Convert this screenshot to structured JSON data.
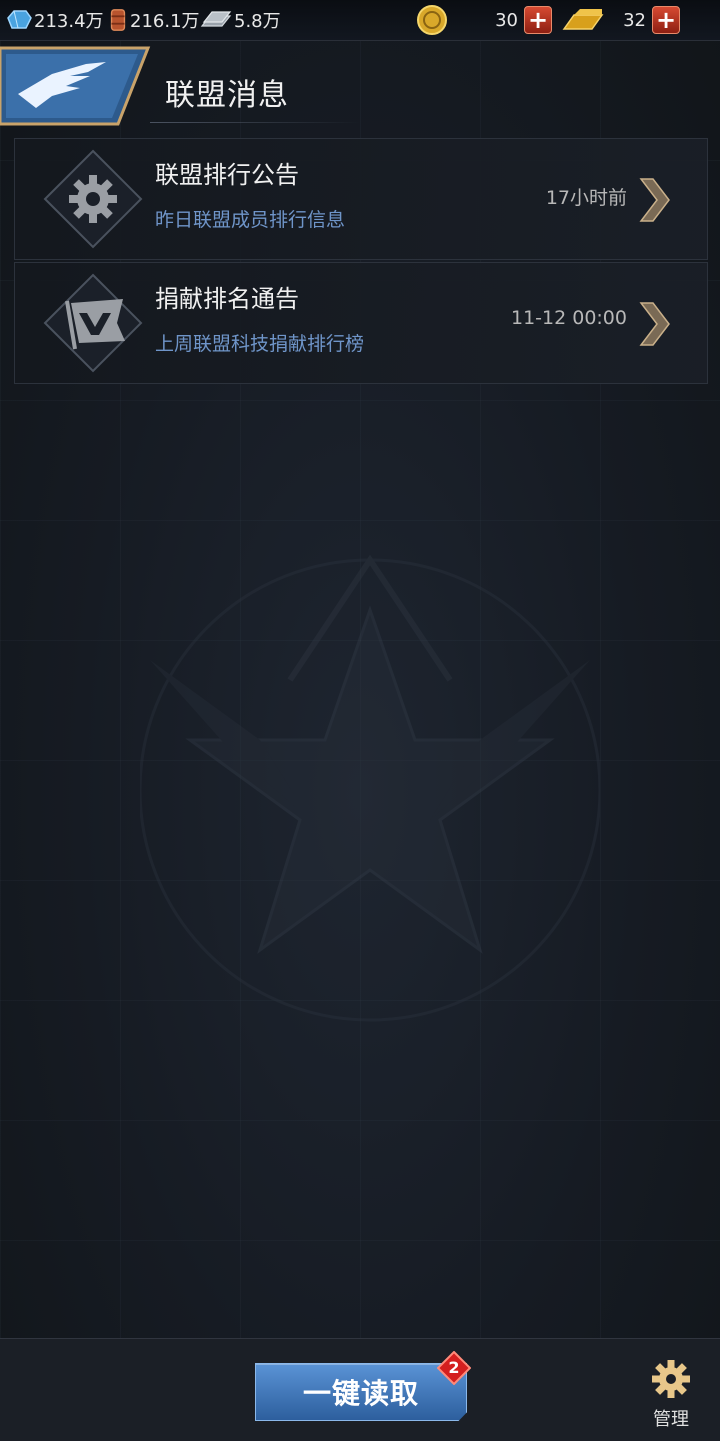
{
  "topbar": {
    "resources": [
      {
        "icon": "crystal-icon",
        "value": "213.4万"
      },
      {
        "icon": "oil-barrel-icon",
        "value": "216.1万"
      },
      {
        "icon": "steel-ingot-icon",
        "value": "5.8万"
      }
    ],
    "premium": [
      {
        "icon": "gold-coin-icon",
        "value": "30"
      },
      {
        "icon": "gold-bar-icon",
        "value": "32"
      }
    ]
  },
  "header": {
    "title": "联盟消息",
    "badge_icon": "eagle-icon"
  },
  "messages": [
    {
      "title": "联盟排行公告",
      "subtitle": "昨日联盟成员排行信息",
      "time": "17小时前",
      "icon": "gear-icon"
    },
    {
      "title": "捐献排名通告",
      "subtitle": "上周联盟科技捐献排行榜",
      "time": "11-12 00:00",
      "icon": "flag-icon"
    }
  ],
  "bottombar": {
    "read_all_label": "一键读取",
    "unread_count": "2",
    "manage_label": "管理"
  },
  "colors": {
    "accent_blue": "#3f7cc4",
    "subtitle_blue": "#6f95c9",
    "badge_red": "#d41f1f"
  }
}
